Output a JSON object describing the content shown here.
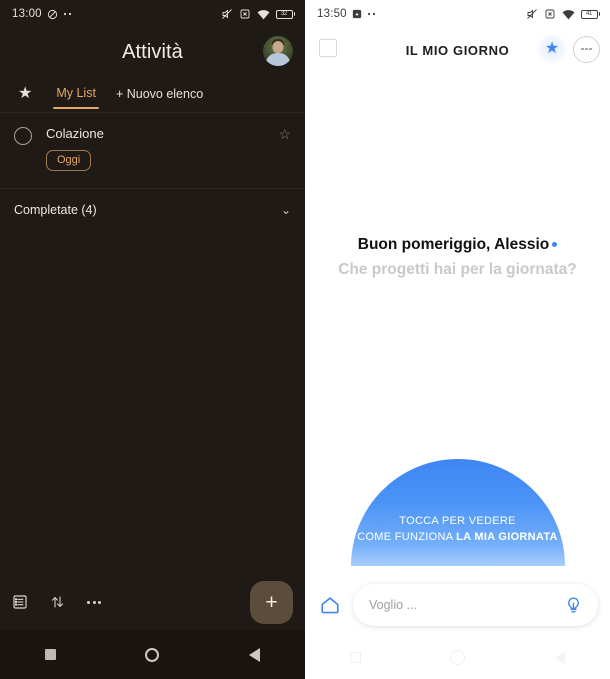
{
  "left_phone": {
    "status_bar": {
      "clock": "13:00",
      "icons": [
        "do-not-disturb-icon",
        "more-dots-icon"
      ],
      "right_icons": [
        "mute-icon",
        "no-sim-icon",
        "wifi-icon"
      ],
      "battery_level": "32"
    },
    "header": {
      "title": "Attività",
      "avatar": "user-avatar"
    },
    "tabs": {
      "star_label": "★",
      "items": [
        {
          "label": "My List",
          "active": true
        },
        {
          "label": "+ Nuovo elenco",
          "active": false
        }
      ]
    },
    "task": {
      "title": "Colazione",
      "chip": "Oggi",
      "star": "☆"
    },
    "completed": {
      "label": "Completate (4)",
      "chevron": "⌄"
    },
    "bottom_bar": {
      "icons": [
        "list-view-icon",
        "sort-icon",
        "overflow-menu-icon"
      ],
      "fab_label": "+"
    },
    "nav_bar": [
      "recents-icon",
      "home-icon",
      "back-icon"
    ]
  },
  "right_phone": {
    "status_bar": {
      "clock": "13:50",
      "icons": [
        "screenshot-icon",
        "more-dots-icon"
      ],
      "right_icons": [
        "mute-icon",
        "no-sim-icon",
        "wifi-icon"
      ],
      "battery_level": "41"
    },
    "header": {
      "checkbox": "selection-checkbox",
      "title": "IL MIO GIORNO",
      "star": "★",
      "more": "overflow-menu-icon"
    },
    "greeting": {
      "main": "Buon pomeriggio, Alessio",
      "sub": "Che progetti hai per la giornata?"
    },
    "dome": {
      "line1": "TOCCA PER VEDERE",
      "line2_prefix": "COME FUNZIONA ",
      "line2_bold": "LA MIA GIORNATA",
      "color_top": "#3f86f3",
      "color_bottom": "#a8cdfc"
    },
    "input_bar": {
      "home_icon": "home-icon",
      "placeholder": "Voglio ...",
      "value": "",
      "bulb_icon": "lightbulb-icon"
    },
    "nav_bar": [
      "recents-icon",
      "home-icon",
      "back-icon"
    ]
  }
}
